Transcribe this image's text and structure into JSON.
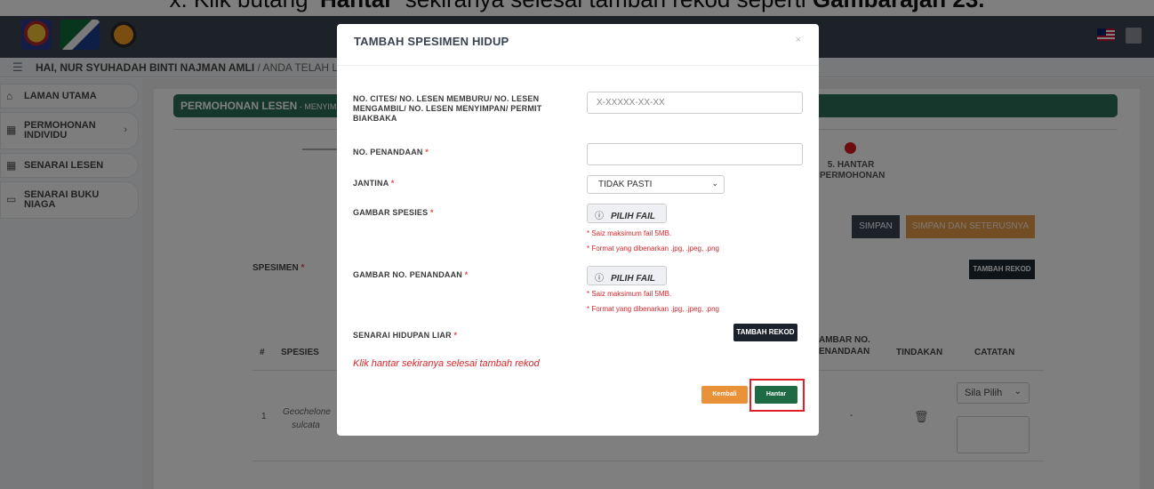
{
  "caption": {
    "prefix": "x. Klik butang ",
    "bold1": "'Hantar'",
    "middle": " sekiranya selesai tambah rekod seperti ",
    "bold2": "Gambarajah 23."
  },
  "header": {
    "user_greeting": "HAI, NUR SYUHADAH BINTI NAJMAN AMLI",
    "user_greeting_suffix": " / ANDA TELAH L"
  },
  "sidebar": {
    "items": [
      {
        "label": "LAMAN UTAMA",
        "icon": "home-icon"
      },
      {
        "label": "PERMOHONAN INDIVIDU",
        "icon": "grid-icon"
      },
      {
        "label": "SENARAI LESEN",
        "icon": "grid-icon"
      },
      {
        "label": "SENARAI BUKU NIAGA",
        "icon": "book-icon"
      }
    ]
  },
  "main": {
    "banner_title": "PERMOHONAN LESEN",
    "banner_sub": " - MENYIMP",
    "step5_label": "5. HANTAR PERMOHONAN",
    "simpan_label": "SIMPAN",
    "simpan_seterusnya_label": "SIMPAN DAN SETERUSNYA",
    "spesimen_label": "SPESIMEN",
    "tambah_rekod_label": "TAMBAH REKOD",
    "table": {
      "headers": [
        "#",
        "SPESIES",
        "AMBAR NO. ENANDAAN",
        "TINDAKAN",
        "CATATAN"
      ],
      "rows": [
        {
          "no": "1",
          "species": "Geochelone sulcata",
          "gambar": "-",
          "catatan_select": "Sila Pilih"
        }
      ]
    }
  },
  "modal": {
    "title": "TAMBAH SPESIMEN HIDUP",
    "close": "×",
    "fields": {
      "cites_label": "NO. CITES/ NO. LESEN MEMBURU/ NO. LESEN MENGAMBIL/ NO. LESEN MENYIMPAN/ PERMIT BIAKBAKA",
      "cites_placeholder": "X-XXXXX-XX-XX",
      "penandaan_label": "NO. PENANDAAN",
      "jantina_label": "JANTINA",
      "jantina_value": "TIDAK PASTI",
      "gambar_spesies_label": "GAMBAR SPESIES",
      "gambar_penandaan_label": "GAMBAR NO. PENANDAAN",
      "pilih_fail": "PILIH FAIL",
      "hint_size": "* Saiz maksimum fail 5MB.",
      "hint_format": "* Format yang dibenarkan .jpg, .jpeg, .png",
      "senarai_label": "SENARAI HIDUPAN LIAR",
      "tambah_rekod": "TAMBAH REKOD",
      "required_mark": "*"
    },
    "note": "Klik hantar sekiranya selesai tambah rekod",
    "kembali_label": "Kembali",
    "hantar_label": "Hantar"
  },
  "colors": {
    "accent_green": "#2b6e58",
    "hantar_green": "#1e6a44",
    "kembali_orange": "#e9923a",
    "required_red": "#d9262b",
    "topbar": "#3a4350"
  }
}
